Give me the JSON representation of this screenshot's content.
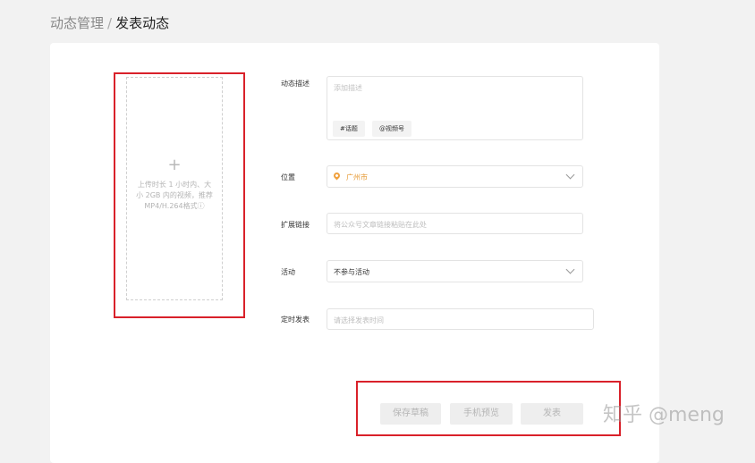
{
  "breadcrumb": {
    "parent": "动态管理",
    "separator": "/",
    "current": "发表动态"
  },
  "upload": {
    "plus": "+",
    "hint": "上传时长 1 小时内、大小 2GB 内的视频，推荐MP4/H.264格式ⓘ"
  },
  "form": {
    "description": {
      "label": "动态描述",
      "placeholder": "添加描述",
      "tags": [
        "#话题",
        "@视频号"
      ]
    },
    "location": {
      "label": "位置",
      "value": "广州市"
    },
    "link": {
      "label": "扩展链接",
      "placeholder": "将公众号文章链接粘贴在此处"
    },
    "activity": {
      "label": "活动",
      "value": "不参与活动"
    },
    "schedule": {
      "label": "定时发表",
      "placeholder": "请选择发表时间"
    }
  },
  "actions": {
    "save_draft": "保存草稿",
    "preview": "手机预览",
    "publish": "发表"
  },
  "watermark": "知乎 @meng",
  "colors": {
    "highlight": "#d9212a",
    "location_accent": "#e69a35"
  }
}
